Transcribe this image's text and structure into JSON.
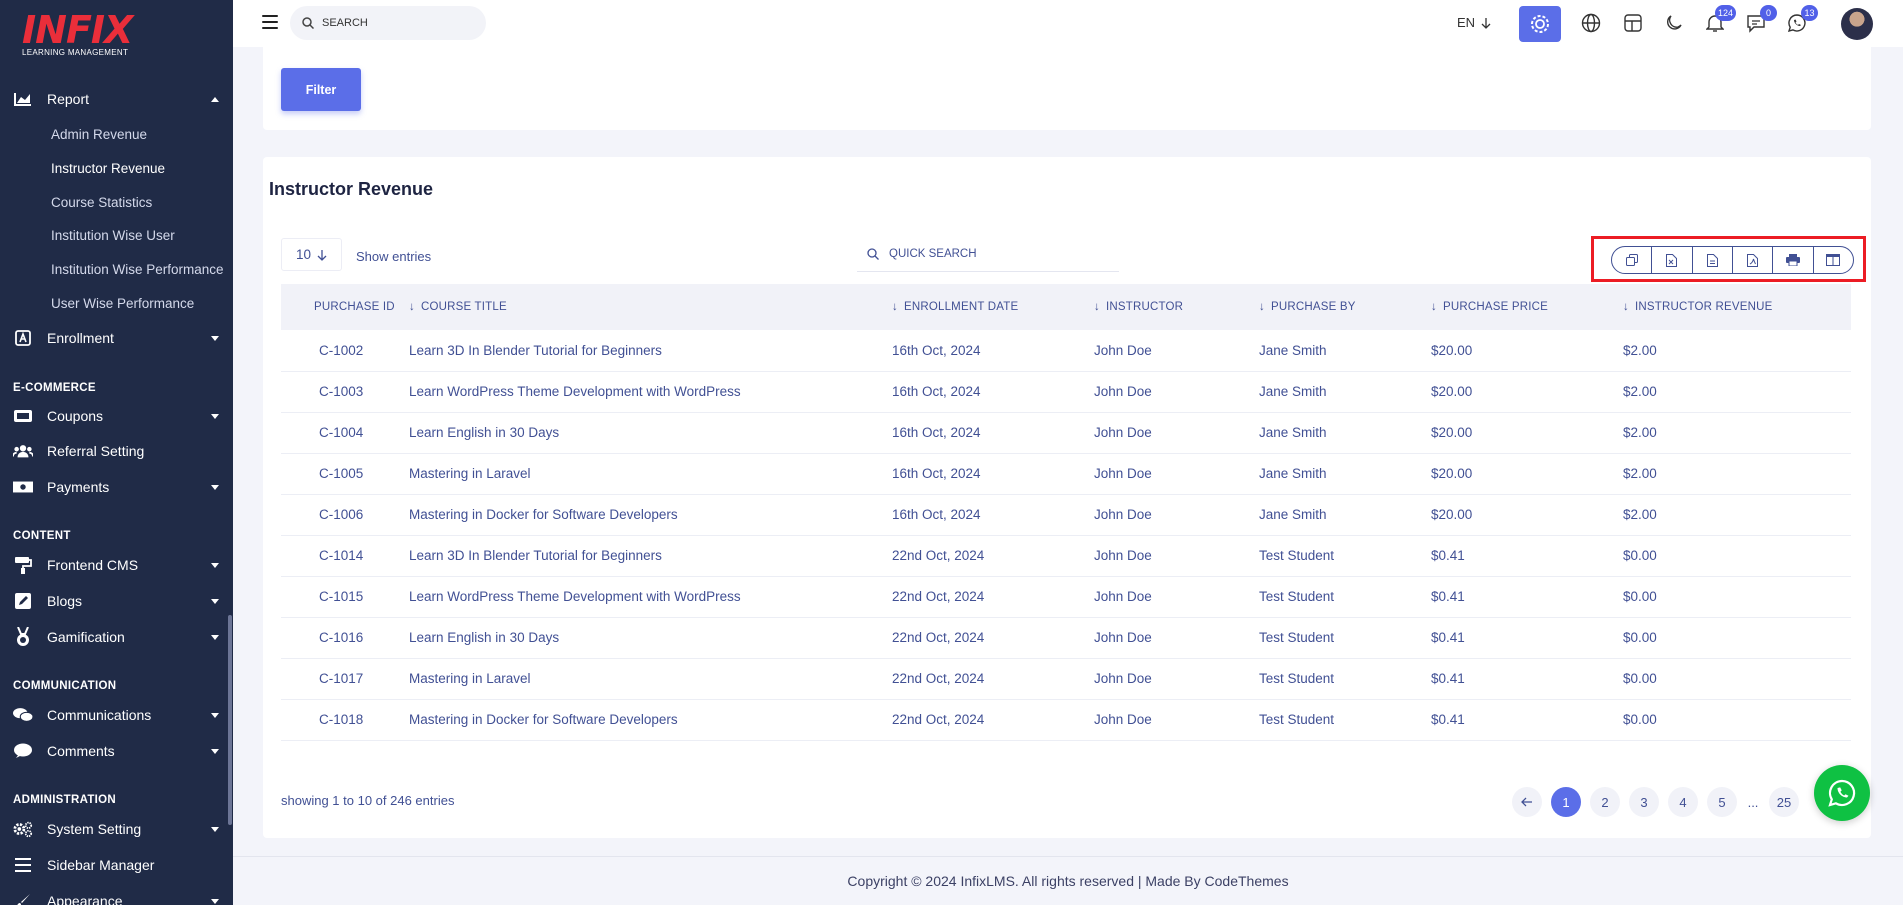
{
  "brand": {
    "name": "INFIX",
    "tagline": "LEARNING MANAGEMENT"
  },
  "sidebar": {
    "report": {
      "label": "Report"
    },
    "report_sub": [
      "Admin Revenue",
      "Instructor Revenue",
      "Course Statistics",
      "Institution Wise User",
      "Institution Wise Performance",
      "User Wise Performance"
    ],
    "enrollment": "Enrollment",
    "sections": {
      "ecommerce": "E-COMMERCE",
      "content": "CONTENT",
      "communication": "COMMUNICATION",
      "administration": "ADMINISTRATION"
    },
    "items": {
      "coupons": "Coupons",
      "referral": "Referral Setting",
      "payments": "Payments",
      "frontend_cms": "Frontend CMS",
      "blogs": "Blogs",
      "gamification": "Gamification",
      "communications": "Communications",
      "comments": "Comments",
      "system_setting": "System Setting",
      "sidebar_manager": "Sidebar Manager",
      "appearance": "Appearance"
    }
  },
  "header": {
    "search_placeholder": "SEARCH",
    "language": "EN",
    "notifications_count": "124",
    "messages_count": "0",
    "whatsapp_count": "13"
  },
  "filter": {
    "button": "Filter"
  },
  "table_card": {
    "title": "Instructor Revenue",
    "page_size": "10",
    "show_entries": "Show entries",
    "quick_search_placeholder": "QUICK SEARCH",
    "columns": [
      "PURCHASE ID",
      "COURSE TITLE",
      "ENROLLMENT DATE",
      "INSTRUCTOR",
      "PURCHASE BY",
      "PURCHASE PRICE",
      "INSTRUCTOR REVENUE"
    ],
    "rows": [
      [
        "C-1002",
        "Learn 3D In Blender Tutorial for Beginners",
        "16th Oct, 2024",
        "John Doe",
        "Jane Smith",
        "$20.00",
        "$2.00"
      ],
      [
        "C-1003",
        "Learn WordPress Theme Development with WordPress",
        "16th Oct, 2024",
        "John Doe",
        "Jane Smith",
        "$20.00",
        "$2.00"
      ],
      [
        "C-1004",
        "Learn English in 30 Days",
        "16th Oct, 2024",
        "John Doe",
        "Jane Smith",
        "$20.00",
        "$2.00"
      ],
      [
        "C-1005",
        "Mastering in Laravel",
        "16th Oct, 2024",
        "John Doe",
        "Jane Smith",
        "$20.00",
        "$2.00"
      ],
      [
        "C-1006",
        "Mastering in Docker for Software Developers",
        "16th Oct, 2024",
        "John Doe",
        "Jane Smith",
        "$20.00",
        "$2.00"
      ],
      [
        "C-1014",
        "Learn 3D In Blender Tutorial for Beginners",
        "22nd Oct, 2024",
        "John Doe",
        "Test Student",
        "$0.41",
        "$0.00"
      ],
      [
        "C-1015",
        "Learn WordPress Theme Development with WordPress",
        "22nd Oct, 2024",
        "John Doe",
        "Test Student",
        "$0.41",
        "$0.00"
      ],
      [
        "C-1016",
        "Learn English in 30 Days",
        "22nd Oct, 2024",
        "John Doe",
        "Test Student",
        "$0.41",
        "$0.00"
      ],
      [
        "C-1017",
        "Mastering in Laravel",
        "22nd Oct, 2024",
        "John Doe",
        "Test Student",
        "$0.41",
        "$0.00"
      ],
      [
        "C-1018",
        "Mastering in Docker for Software Developers",
        "22nd Oct, 2024",
        "John Doe",
        "Test Student",
        "$0.41",
        "$0.00"
      ]
    ],
    "showing": "showing 1 to 10 of 246 entries",
    "pages": [
      "1",
      "2",
      "3",
      "4",
      "5",
      "...",
      "25"
    ]
  },
  "footer": {
    "text": "Copyright © 2024 InfixLMS. All rights reserved | Made By CodeThemes"
  },
  "colors": {
    "sidebar_bg": "#202b47",
    "accent": "#5b6ee8",
    "brand_red": "#ea2e3a",
    "whatsapp": "#0fc143",
    "highlight_border": "#ec1c24"
  }
}
